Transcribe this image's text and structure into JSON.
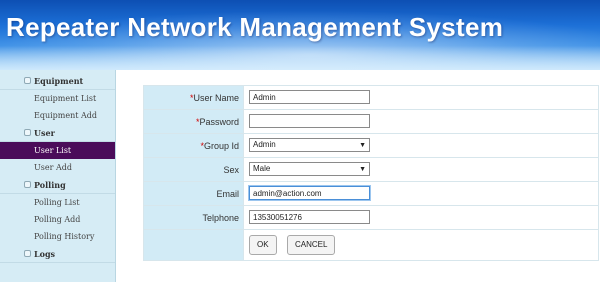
{
  "header": {
    "title": "Repeater Network Management System"
  },
  "sidebar": {
    "sections": [
      {
        "label": "Equipment",
        "items": [
          "Equipment List",
          "Equipment Add"
        ]
      },
      {
        "label": "User",
        "items": [
          "User List",
          "User Add"
        ],
        "active_item": "User List"
      },
      {
        "label": "Polling",
        "items": [
          "Polling List",
          "Polling Add",
          "Polling History"
        ]
      },
      {
        "label": "Logs",
        "items": []
      }
    ]
  },
  "form": {
    "required_mark": "*",
    "fields": {
      "user_name": {
        "label": "User Name",
        "value": "Admin"
      },
      "password": {
        "label": "Password",
        "value": ""
      },
      "group_id": {
        "label": "Group Id",
        "value": "Admin"
      },
      "sex": {
        "label": "Sex",
        "value": "Male"
      },
      "email": {
        "label": "Email",
        "value": "admin@action.com"
      },
      "telphone": {
        "label": "Telphone",
        "value": "13530051276"
      }
    },
    "buttons": {
      "ok": "OK",
      "cancel": "CANCEL"
    }
  },
  "colors": {
    "sidebar_bg": "#d6ecf5",
    "active_item_bg": "#4b0c5a",
    "label_cell_bg": "#d2ebf6",
    "required_mark": "#d00000",
    "banner_blue": "#1c6fd6"
  },
  "icons": {
    "section_toggle": "collapse-square-icon",
    "select_arrow": "chevron-down-icon"
  }
}
